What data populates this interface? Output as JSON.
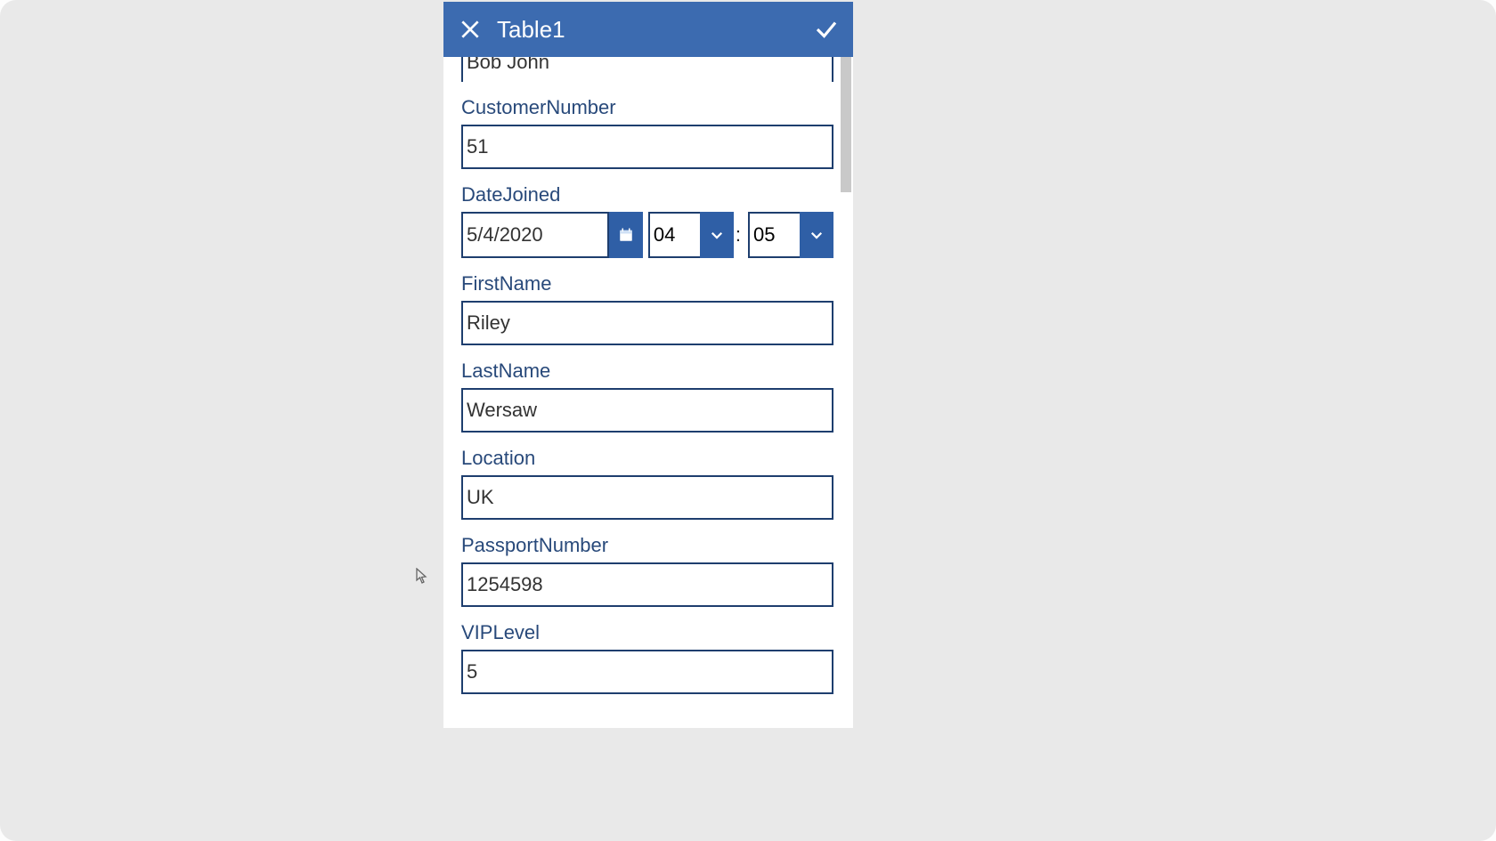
{
  "header": {
    "title": "Table1"
  },
  "fields": {
    "top_cut_value": "Bob John",
    "customer_number": {
      "label": "CustomerNumber",
      "value": "51"
    },
    "date_joined": {
      "label": "DateJoined",
      "date": "5/4/2020",
      "hour": "04",
      "minute": "05"
    },
    "first_name": {
      "label": "FirstName",
      "value": "Riley"
    },
    "last_name": {
      "label": "LastName",
      "value": "Wersaw"
    },
    "location": {
      "label": "Location",
      "value": "UK"
    },
    "passport_number": {
      "label": "PassportNumber",
      "value": "1254598"
    },
    "vip_level": {
      "label": "VIPLevel",
      "value": "5"
    }
  }
}
